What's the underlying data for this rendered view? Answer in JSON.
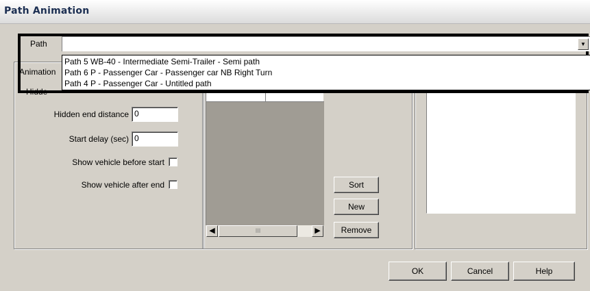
{
  "window": {
    "title": "Path Animation"
  },
  "path_field": {
    "label": "Path",
    "value": "",
    "dropdown_arrow_icon": "chevron-down-icon",
    "options": [
      "Path 5 WB-40 - Intermediate Semi-Trailer - Semi path",
      "Path 6 P - Passenger Car - Passenger car NB Right Turn",
      "Path 4 P - Passenger Car - Untitled path"
    ]
  },
  "settings": {
    "animation_label_partial": "Animation",
    "hidden_label_partial": "Hidde",
    "hidden_end_distance": {
      "label": "Hidden end distance",
      "value": "0"
    },
    "start_delay": {
      "label": "Start delay (sec)",
      "value": "0"
    },
    "show_before_start": {
      "label": "Show vehicle before start",
      "checked": false
    },
    "show_after_end": {
      "label": "Show vehicle after end",
      "checked": false
    }
  },
  "list": {
    "scroll_left_icon": "chevron-left-icon",
    "scroll_right_icon": "chevron-right-icon",
    "thumb_grip": "III"
  },
  "side_buttons": {
    "sort": "Sort",
    "new": "New",
    "remove": "Remove"
  },
  "footer": {
    "ok": "OK",
    "cancel": "Cancel",
    "help": "Help"
  },
  "colors": {
    "dialog_bg": "#d4d0c8",
    "highlight_border": "#000000",
    "list_bg": "#a09c94"
  }
}
